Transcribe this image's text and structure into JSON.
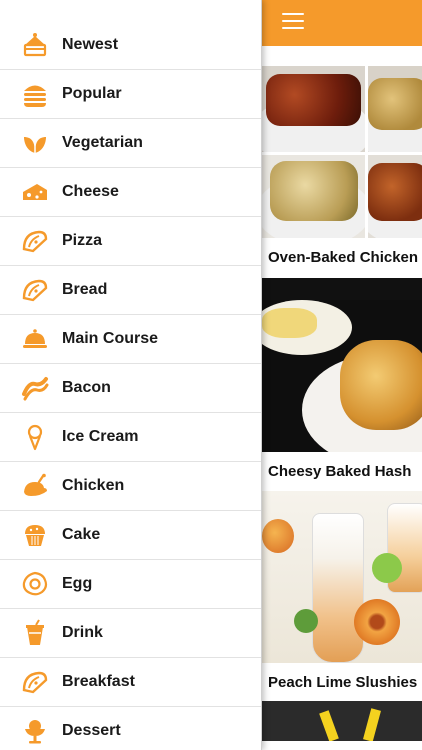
{
  "accent_color": "#f59a2b",
  "menu": {
    "items": [
      {
        "label": "Newest",
        "icon": "cake-slice-icon"
      },
      {
        "label": "Popular",
        "icon": "burger-icon"
      },
      {
        "label": "Vegetarian",
        "icon": "leaf-icon"
      },
      {
        "label": "Cheese",
        "icon": "cheese-icon"
      },
      {
        "label": "Pizza",
        "icon": "taco-icon"
      },
      {
        "label": "Bread",
        "icon": "taco-icon"
      },
      {
        "label": "Main Course",
        "icon": "cloche-icon"
      },
      {
        "label": "Bacon",
        "icon": "bacon-icon"
      },
      {
        "label": "Ice Cream",
        "icon": "ice-cream-icon"
      },
      {
        "label": "Chicken",
        "icon": "roast-chicken-icon"
      },
      {
        "label": "Cake",
        "icon": "muffin-icon"
      },
      {
        "label": "Egg",
        "icon": "egg-icon"
      },
      {
        "label": "Drink",
        "icon": "drink-cup-icon"
      },
      {
        "label": "Breakfast",
        "icon": "taco-icon"
      },
      {
        "label": "Dessert",
        "icon": "sundae-icon"
      }
    ]
  },
  "main": {
    "recipes": [
      {
        "title": "Oven-Baked Chicken"
      },
      {
        "title": "Cheesy Baked Hash"
      },
      {
        "title": "Peach Lime Slushies"
      }
    ]
  }
}
